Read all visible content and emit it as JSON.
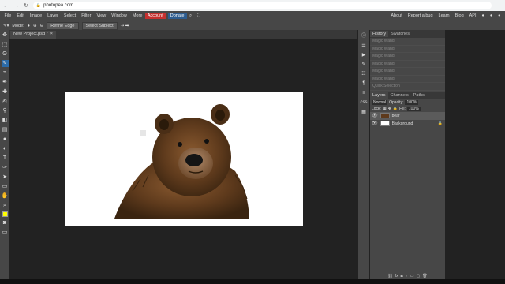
{
  "browser": {
    "url": "photopea.com"
  },
  "menu": {
    "items": [
      "File",
      "Edit",
      "Image",
      "Layer",
      "Select",
      "Filter",
      "View",
      "Window",
      "More"
    ],
    "account": "Account",
    "donate": "Donate",
    "right_links": [
      "About",
      "Report a bug",
      "Learn",
      "Blog",
      "API"
    ]
  },
  "options": {
    "mode_label": "Mode:",
    "refine_edge": "Refine Edge",
    "select_subject": "Select Subject"
  },
  "document": {
    "tab_title": "New Project.psd *",
    "close": "×"
  },
  "colors": {
    "fg": "#ffff00",
    "bg": "#ffffff",
    "accent_red": "#c5302f"
  },
  "history": {
    "tabs": [
      "History",
      "Swatches"
    ],
    "items": [
      "Magic Wand",
      "Magic Wand",
      "Magic Wand",
      "Magic Wand",
      "Magic Wand",
      "Magic Wand",
      "Quick Selection"
    ]
  },
  "layers": {
    "tabs": [
      "Layers",
      "Channels",
      "Paths"
    ],
    "blend_mode": "Normal",
    "opacity_label": "Opacity:",
    "opacity_value": "100%",
    "lock_label": "Lock:",
    "fill_label": "Fill:",
    "fill_value": "100%",
    "items": [
      {
        "name": "bear"
      },
      {
        "name": "Background"
      }
    ]
  }
}
